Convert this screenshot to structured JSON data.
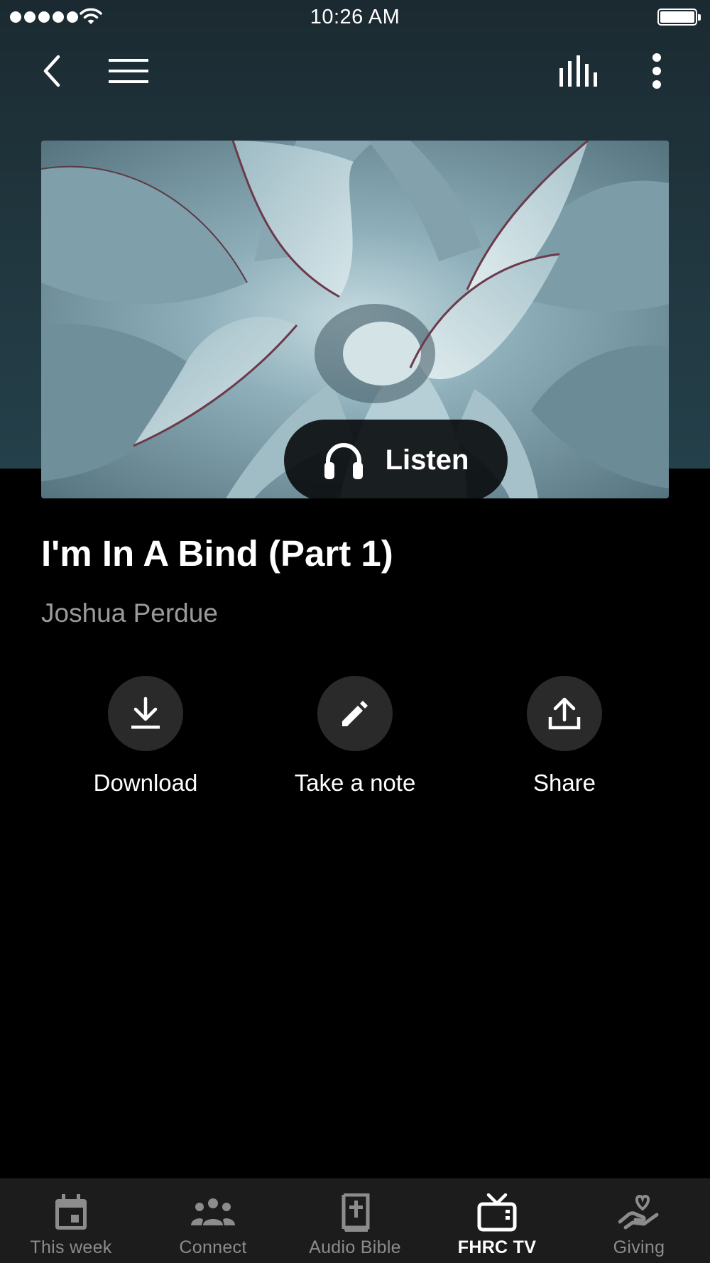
{
  "status_bar": {
    "time": "10:26 AM"
  },
  "header": {
    "back_icon": "chevron-left-icon",
    "menu_icon": "hamburger-icon",
    "now_playing_icon": "equalizer-icon",
    "more_icon": "vertical-dots-icon"
  },
  "hero": {
    "listen_label": "Listen",
    "listen_icon": "headphones-icon"
  },
  "sermon": {
    "title": "I'm In A Bind (Part 1)",
    "speaker": "Joshua Perdue"
  },
  "actions": [
    {
      "label": "Download",
      "icon": "download-icon"
    },
    {
      "label": "Take a note",
      "icon": "pencil-icon"
    },
    {
      "label": "Share",
      "icon": "share-icon"
    }
  ],
  "tabs": [
    {
      "label": "This week",
      "icon": "calendar-icon",
      "active": false
    },
    {
      "label": "Connect",
      "icon": "people-icon",
      "active": false
    },
    {
      "label": "Audio Bible",
      "icon": "bible-icon",
      "active": false
    },
    {
      "label": "FHRC TV",
      "icon": "tv-icon",
      "active": true
    },
    {
      "label": "Giving",
      "icon": "giving-hand-icon",
      "active": false
    }
  ],
  "colors": {
    "header_bg": "#213740",
    "page_bg": "#000000",
    "tabbar_bg": "#1c1c1c",
    "inactive_tab": "#8c8c8c",
    "action_circle": "#2a2a2a",
    "speaker_text": "#9a9a9a"
  }
}
